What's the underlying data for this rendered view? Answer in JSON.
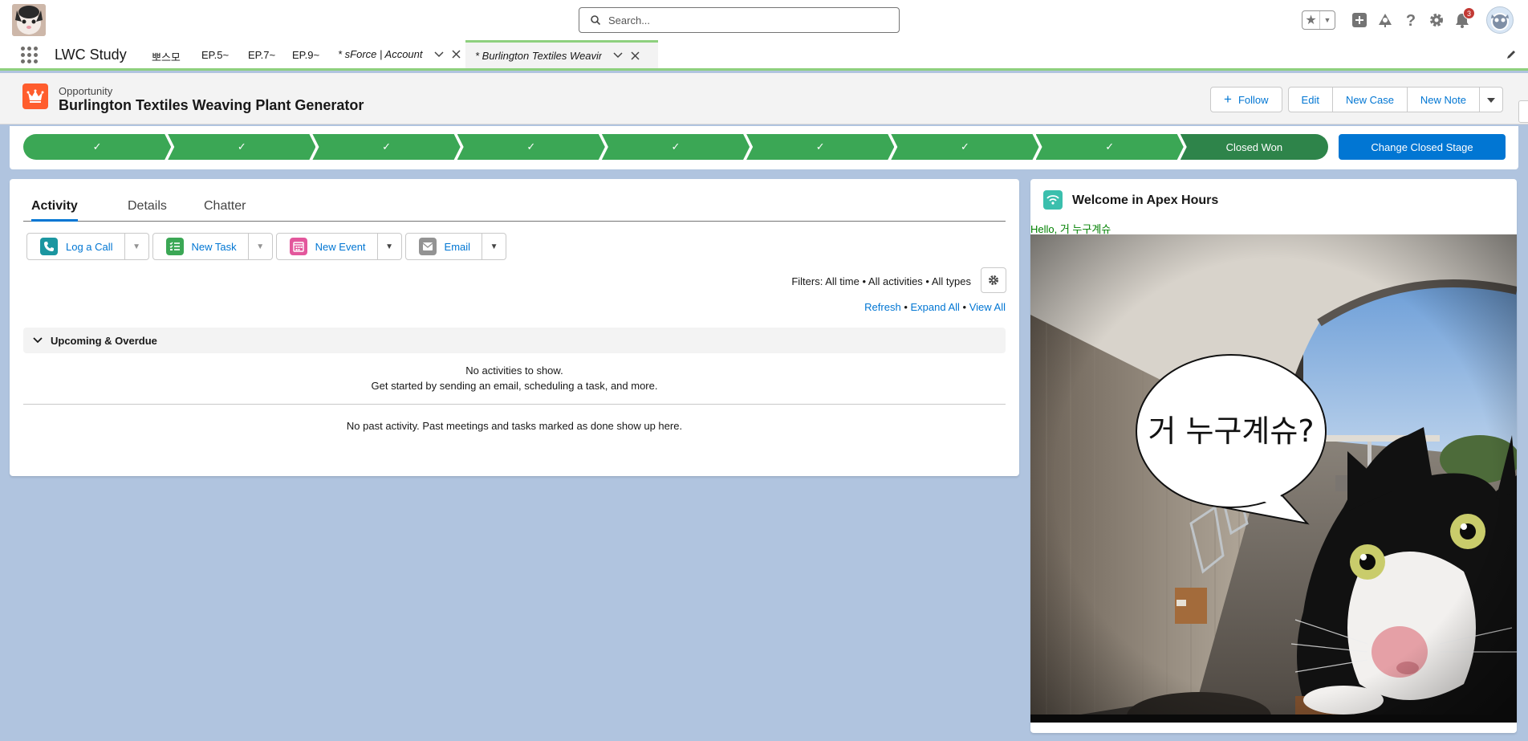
{
  "header": {
    "search_placeholder": "Search...",
    "notification_count": "3"
  },
  "nav": {
    "app_name": "LWC Study",
    "items": [
      "뽀스모",
      "EP.5~",
      "EP.7~",
      "EP.9~"
    ],
    "tabs": [
      {
        "label": "* sForce | Account"
      },
      {
        "label": "* Burlington Textiles Weavin..."
      }
    ]
  },
  "record": {
    "object_type": "Opportunity",
    "title": "Burlington Textiles Weaving Plant Generator",
    "buttons": {
      "follow": "Follow",
      "edit": "Edit",
      "new_case": "New Case",
      "new_note": "New Note"
    }
  },
  "path": {
    "current_stage": "Closed Won",
    "change_button": "Change Closed Stage"
  },
  "activity": {
    "tabs": [
      "Activity",
      "Details",
      "Chatter"
    ],
    "buttons": {
      "log_call": "Log a Call",
      "new_task": "New Task",
      "new_event": "New Event",
      "email": "Email"
    },
    "filters": "Filters: All time • All activities • All types",
    "links": {
      "refresh": "Refresh",
      "expand_all": "Expand All",
      "view_all": "View All",
      "sep": " • "
    },
    "upcoming_title": "Upcoming & Overdue",
    "no_activities": "No activities to show.",
    "get_started": "Get started by sending an email, scheduling a task, and more.",
    "no_past": "No past activity. Past meetings and tasks marked as done show up here."
  },
  "apex": {
    "title": "Welcome in Apex Hours",
    "hello": "Hello, 거 누구계슈",
    "bubble_text": "거 누구계슈?"
  },
  "colors": {
    "accent": "#0176d3",
    "path_complete": "#3ba755",
    "path_current": "#2e844a",
    "opportunity_icon": "#ff5d2d",
    "nav_active": "#8ed07e",
    "background": "#b0c4df"
  }
}
